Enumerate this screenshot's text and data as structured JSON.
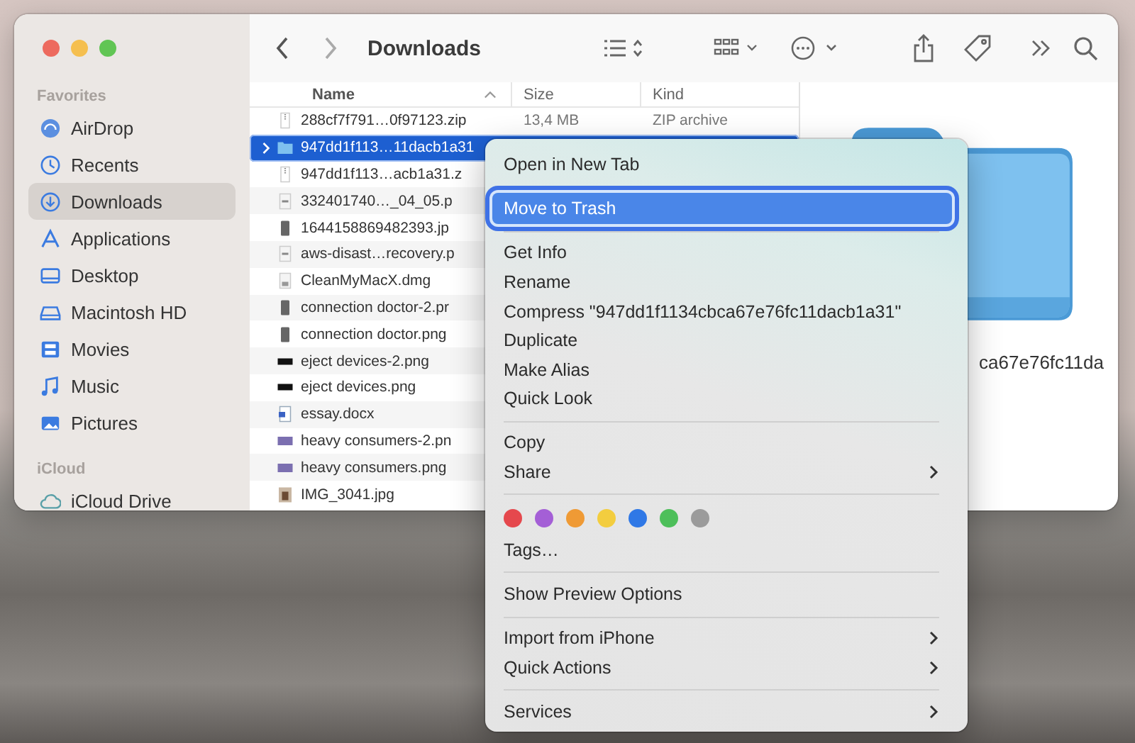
{
  "window": {
    "title": "Downloads"
  },
  "sidebar": {
    "sections": [
      {
        "header": "Favorites",
        "items": [
          {
            "label": "AirDrop",
            "selected": false
          },
          {
            "label": "Recents",
            "selected": false
          },
          {
            "label": "Downloads",
            "selected": true
          },
          {
            "label": "Applications",
            "selected": false
          },
          {
            "label": "Desktop",
            "selected": false
          },
          {
            "label": "Macintosh HD",
            "selected": false
          },
          {
            "label": "Movies",
            "selected": false
          },
          {
            "label": "Music",
            "selected": false
          },
          {
            "label": "Pictures",
            "selected": false
          }
        ]
      },
      {
        "header": "iCloud",
        "items": [
          {
            "label": "iCloud Drive",
            "selected": false
          }
        ]
      }
    ]
  },
  "file_list": {
    "columns": [
      "Name",
      "Size",
      "Kind"
    ],
    "rows": [
      {
        "kind": "archive",
        "name": "288cf7f791…0f97123.zip",
        "size": "13,4 MB",
        "type": "ZIP archive",
        "selected": false,
        "expandable": false
      },
      {
        "kind": "folder",
        "name": "947dd1f113…11dacb1a31",
        "selected": true,
        "expandable": true
      },
      {
        "kind": "archive",
        "name": "947dd1f113…acb1a31.z",
        "selected": false,
        "expandable": false
      },
      {
        "kind": "document",
        "name": "332401740…_04_05.p",
        "selected": false,
        "expandable": false
      },
      {
        "kind": "phone",
        "name": "1644158869482393.jp",
        "selected": false,
        "expandable": false
      },
      {
        "kind": "document",
        "name": "aws-disast…recovery.p",
        "selected": false,
        "expandable": false
      },
      {
        "kind": "disk",
        "name": "CleanMyMacX.dmg",
        "selected": false,
        "expandable": false
      },
      {
        "kind": "phone",
        "name": "connection doctor-2.pr",
        "selected": false,
        "expandable": false
      },
      {
        "kind": "phone",
        "name": "connection doctor.png",
        "selected": false,
        "expandable": false
      },
      {
        "kind": "screen",
        "name": "eject devices-2.png",
        "selected": false,
        "expandable": false
      },
      {
        "kind": "screen",
        "name": "eject devices.png",
        "selected": false,
        "expandable": false
      },
      {
        "kind": "word",
        "name": "essay.docx",
        "selected": false,
        "expandable": false
      },
      {
        "kind": "chart",
        "name": "heavy consumers-2.pn",
        "selected": false,
        "expandable": false
      },
      {
        "kind": "chart",
        "name": "heavy consumers.png",
        "selected": false,
        "expandable": false
      },
      {
        "kind": "photo",
        "name": "IMG_3041.jpg",
        "selected": false,
        "expandable": false
      }
    ]
  },
  "preview": {
    "name": "ca67e76fc11da"
  },
  "context_menu": {
    "items": [
      {
        "kind": "item",
        "label": "Open in New Tab",
        "selected": false,
        "submenu": false
      },
      {
        "kind": "item",
        "label": "Move to Trash",
        "selected": true,
        "submenu": false
      },
      {
        "kind": "separator"
      },
      {
        "kind": "item",
        "label": "Get Info",
        "selected": false,
        "submenu": false
      },
      {
        "kind": "item",
        "label": "Rename",
        "selected": false,
        "submenu": false
      },
      {
        "kind": "item",
        "label": "Compress \"947dd1f1134cbca67e76fc11dacb1a31\"",
        "selected": false,
        "submenu": false
      },
      {
        "kind": "item",
        "label": "Duplicate",
        "selected": false,
        "submenu": false
      },
      {
        "kind": "item",
        "label": "Make Alias",
        "selected": false,
        "submenu": false
      },
      {
        "kind": "item",
        "label": "Quick Look",
        "selected": false,
        "submenu": false
      },
      {
        "kind": "separator"
      },
      {
        "kind": "item",
        "label": "Copy",
        "selected": false,
        "submenu": false
      },
      {
        "kind": "item",
        "label": "Share",
        "selected": false,
        "submenu": true
      },
      {
        "kind": "separator"
      },
      {
        "kind": "tags",
        "colors": [
          {
            "color": "#e5484d"
          },
          {
            "color": "#a45fd6"
          },
          {
            "color": "#ef9a35"
          },
          {
            "color": "#f3cd3f"
          },
          {
            "color": "#2f78e6"
          },
          {
            "color": "#4dbf5a"
          },
          {
            "color": "#9b9b9b"
          }
        ]
      },
      {
        "kind": "item",
        "label": "Tags…",
        "selected": false,
        "submenu": false
      },
      {
        "kind": "separator"
      },
      {
        "kind": "item",
        "label": "Show Preview Options",
        "selected": false,
        "submenu": false
      },
      {
        "kind": "separator"
      },
      {
        "kind": "item",
        "label": "Import from iPhone",
        "selected": false,
        "submenu": true
      },
      {
        "kind": "item",
        "label": "Quick Actions",
        "selected": false,
        "submenu": true
      },
      {
        "kind": "separator"
      },
      {
        "kind": "item",
        "label": "Services",
        "selected": false,
        "submenu": true
      }
    ]
  }
}
